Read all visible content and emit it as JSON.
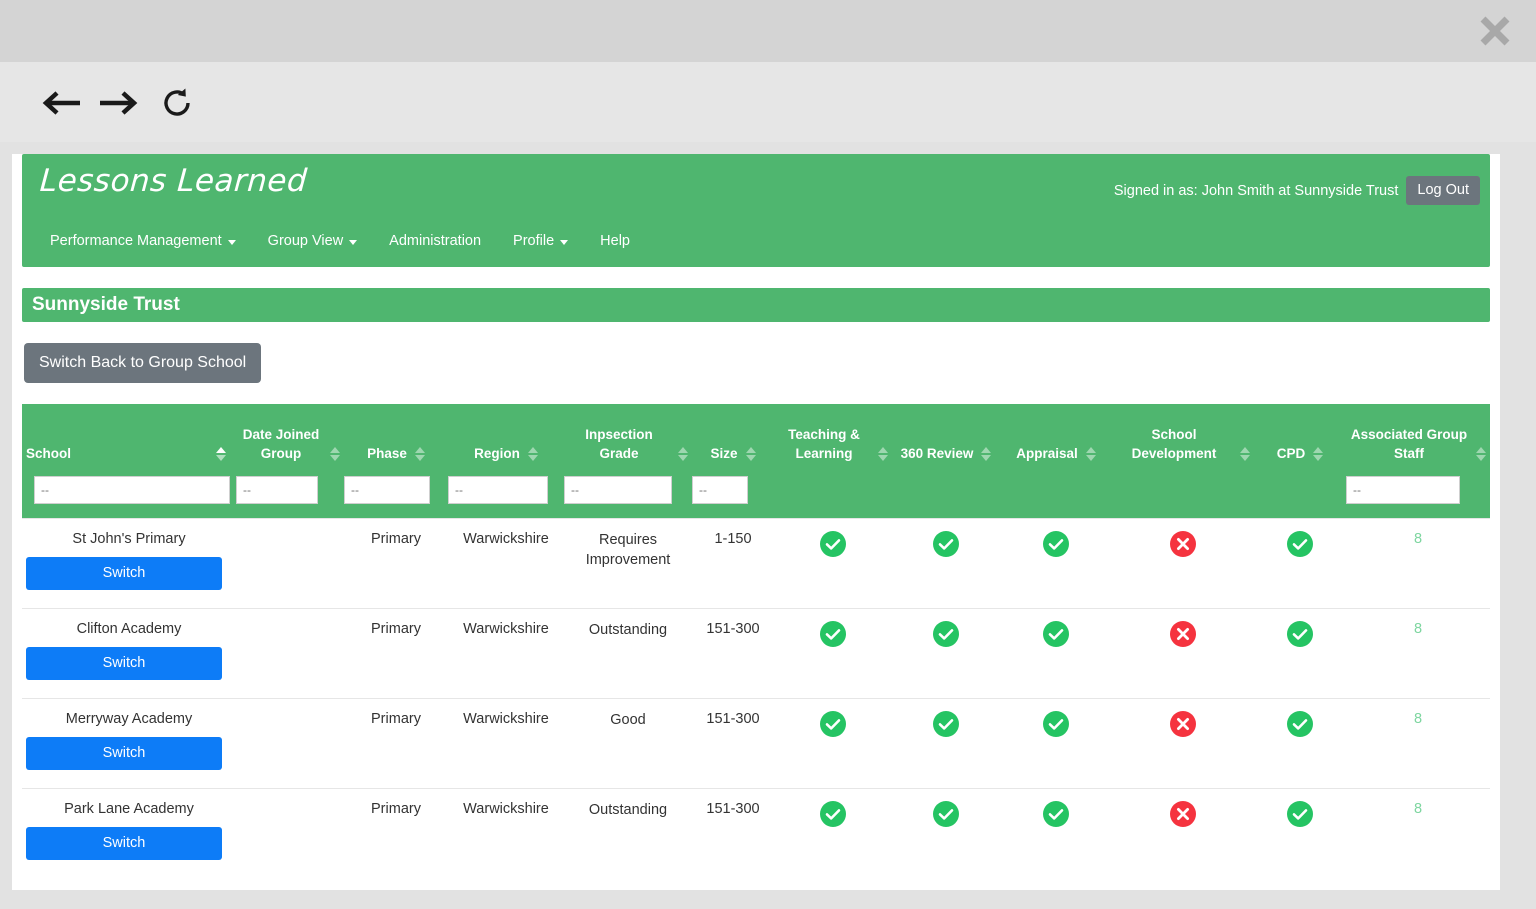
{
  "browser": {
    "close_label": "close-icon",
    "back_label": "back-arrow-icon",
    "forward_label": "forward-arrow-icon",
    "reload_label": "reload-icon",
    "address_value": "",
    "address_placeholder": ""
  },
  "app": {
    "brand": "Lessons Learned",
    "signed_in_text": "Signed in as: John Smith at Sunnyside Trust",
    "logout_label": "Log Out",
    "nav": [
      {
        "label": "Performance Management",
        "has_caret": true
      },
      {
        "label": "Group View",
        "has_caret": true
      },
      {
        "label": "Administration",
        "has_caret": false
      },
      {
        "label": "Profile",
        "has_caret": true
      },
      {
        "label": "Help",
        "has_caret": false
      }
    ],
    "trust_title": "Sunnyside Trust",
    "switch_back_label": "Switch Back to Group School",
    "accent_green": "#4fb66f",
    "button_blue": "#0d7cf7",
    "button_grey": "#6c757d",
    "status_green": "#25c463",
    "status_red": "#f5333f",
    "link_green": "#7ed6a0"
  },
  "table": {
    "columns": [
      {
        "label": "School",
        "sortable": true,
        "active_sort": true
      },
      {
        "label": "Date Joined Group",
        "sortable": true,
        "active_sort": false
      },
      {
        "label": "Phase",
        "sortable": true,
        "active_sort": false
      },
      {
        "label": "Region",
        "sortable": true,
        "active_sort": false
      },
      {
        "label": "Inpsection Grade",
        "sortable": true,
        "active_sort": false
      },
      {
        "label": "Size",
        "sortable": true,
        "active_sort": false
      },
      {
        "label": "Teaching & Learning",
        "sortable": true,
        "active_sort": false
      },
      {
        "label": "360 Review",
        "sortable": true,
        "active_sort": false
      },
      {
        "label": "Appraisal",
        "sortable": true,
        "active_sort": false
      },
      {
        "label": "School Development",
        "sortable": true,
        "active_sort": false
      },
      {
        "label": "CPD",
        "sortable": true,
        "active_sort": false
      },
      {
        "label": "Associated Group Staff",
        "sortable": true,
        "active_sort": false
      }
    ],
    "filter_placeholder": "--",
    "filters": {
      "school": "",
      "date_joined": "",
      "phase": "",
      "region": "",
      "grade": "",
      "size": "",
      "staff": ""
    },
    "switch_label": "Switch",
    "rows": [
      {
        "school": "St John's Primary",
        "date_joined": "",
        "phase": "Primary",
        "region": "Warwickshire",
        "grade": "Requires Improvement",
        "size": "1-150",
        "teaching_learning": "tick",
        "review_360": "tick",
        "appraisal": "tick",
        "school_development": "cross",
        "cpd": "tick",
        "associated_group_staff": "8"
      },
      {
        "school": "Clifton Academy",
        "date_joined": "",
        "phase": "Primary",
        "region": "Warwickshire",
        "grade": "Outstanding",
        "size": "151-300",
        "teaching_learning": "tick",
        "review_360": "tick",
        "appraisal": "tick",
        "school_development": "cross",
        "cpd": "tick",
        "associated_group_staff": "8"
      },
      {
        "school": "Merryway Academy",
        "date_joined": "",
        "phase": "Primary",
        "region": "Warwickshire",
        "grade": "Good",
        "size": "151-300",
        "teaching_learning": "tick",
        "review_360": "tick",
        "appraisal": "tick",
        "school_development": "cross",
        "cpd": "tick",
        "associated_group_staff": "8"
      },
      {
        "school": "Park Lane Academy",
        "date_joined": "",
        "phase": "Primary",
        "region": "Warwickshire",
        "grade": "Outstanding",
        "size": "151-300",
        "teaching_learning": "tick",
        "review_360": "tick",
        "appraisal": "tick",
        "school_development": "cross",
        "cpd": "tick",
        "associated_group_staff": "8"
      }
    ]
  }
}
